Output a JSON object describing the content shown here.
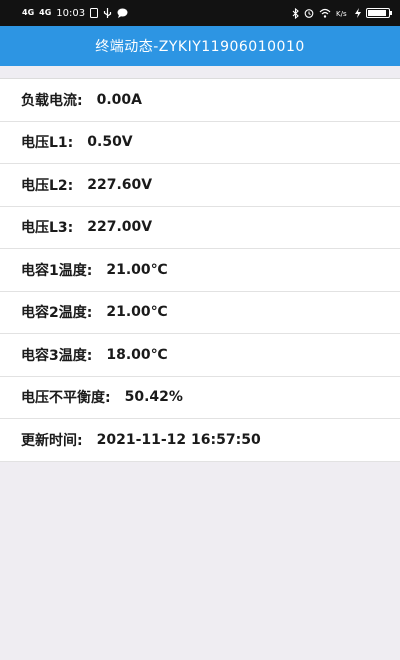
{
  "status_bar": {
    "signal1": "4G",
    "signal2": "4G",
    "time": "10:03",
    "icons_left": [
      "sim-icon",
      "usb-icon",
      "chat-icon"
    ],
    "icons_right": [
      "bluetooth-icon",
      "alarm-icon",
      "wifi-icon",
      "speed-icon",
      "charging-icon",
      "battery-icon"
    ],
    "battery_level": 0.9
  },
  "header": {
    "title": "终端动态-ZYKIY11906010010"
  },
  "rows": [
    {
      "label": "负载电流:",
      "value": "0.00A"
    },
    {
      "label": "电压L1:",
      "value": "0.50V"
    },
    {
      "label": "电压L2:",
      "value": "227.60V"
    },
    {
      "label": "电压L3:",
      "value": "227.00V"
    },
    {
      "label": "电容1温度:",
      "value": "21.00℃"
    },
    {
      "label": "电容2温度:",
      "value": "21.00℃"
    },
    {
      "label": "电容3温度:",
      "value": "18.00℃"
    },
    {
      "label": "电压不平衡度:",
      "value": "50.42%"
    },
    {
      "label": "更新时间:",
      "value": "2021-11-12 16:57:50"
    }
  ]
}
